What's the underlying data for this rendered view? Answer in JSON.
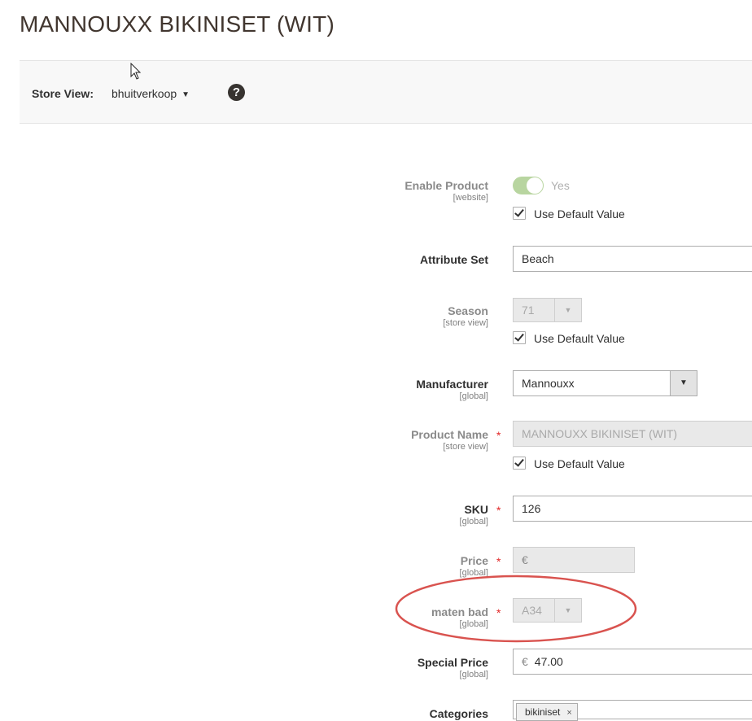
{
  "page": {
    "title": "MANNOUXX BIKINISET (WIT)"
  },
  "store_view": {
    "label": "Store View:",
    "value": "bhuitverkoop",
    "help": "?"
  },
  "fields": {
    "enable_product": {
      "label": "Enable Product",
      "scope": "[website]",
      "toggle_label": "Yes",
      "use_default": "Use Default Value"
    },
    "attribute_set": {
      "label": "Attribute Set",
      "value": "Beach"
    },
    "season": {
      "label": "Season",
      "scope": "[store view]",
      "value": "71",
      "use_default": "Use Default Value"
    },
    "manufacturer": {
      "label": "Manufacturer",
      "scope": "[global]",
      "value": "Mannouxx"
    },
    "product_name": {
      "label": "Product Name",
      "scope": "[store view]",
      "value": "MANNOUXX BIKINISET (WIT)",
      "use_default": "Use Default Value"
    },
    "sku": {
      "label": "SKU",
      "scope": "[global]",
      "value": "126"
    },
    "price": {
      "label": "Price",
      "scope": "[global]",
      "currency": "€",
      "value": ""
    },
    "maten_bad": {
      "label": "maten bad",
      "scope": "[global]",
      "value": "A34"
    },
    "special_price": {
      "label": "Special Price",
      "scope": "[global]",
      "currency": "€",
      "value": "47.00"
    },
    "categories": {
      "label": "Categories",
      "tags": [
        "bikiniset"
      ],
      "remove_glyph": "×"
    }
  },
  "required_marker": "*",
  "colors": {
    "highlight": "#d9534f",
    "required": "#e22626",
    "toggle_on": "#b8d5a0"
  }
}
